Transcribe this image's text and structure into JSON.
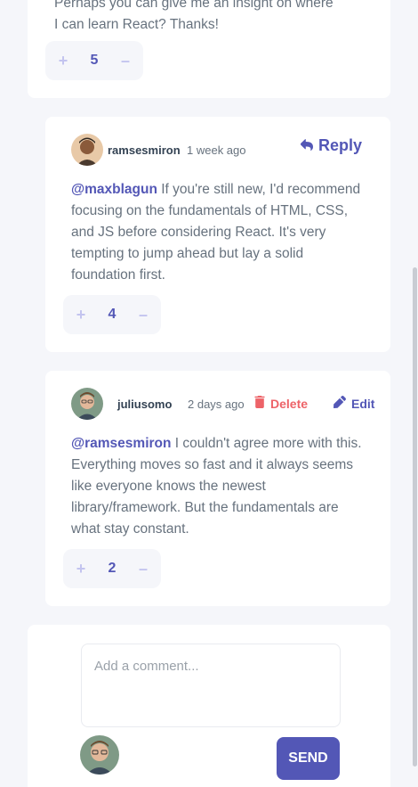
{
  "top_comment": {
    "text_line1": "Perhaps you can give me an insight on where",
    "text_line2": "I can learn React? Thanks!",
    "score": "5"
  },
  "reply_comment": {
    "username": "ramsesmiron",
    "time": "1 week ago",
    "reply_label": "Reply",
    "mention": "@maxblagun",
    "text": " If you're still new, I'd recommend focusing on the fundamentals of HTML, CSS, and JS before considering React. It's very tempting to jump ahead but lay a solid foundation first.",
    "score": "4"
  },
  "own_comment": {
    "username": "juliusomo",
    "time": "2 days ago",
    "delete_label": "Delete",
    "edit_label": "Edit",
    "mention": "@ramsesmiron",
    "text": " I couldn't agree more with this. Everything moves so fast and it always seems like everyone knows the newest library/framework. But the fundamentals are what stay constant.",
    "score": "2"
  },
  "vote": {
    "plus": "+",
    "minus": "–"
  },
  "compose": {
    "placeholder": "Add a comment...",
    "send_label": "SEND"
  },
  "colors": {
    "accent": "#5357b6",
    "danger": "#ed6368",
    "background": "#f5f6fa"
  },
  "icons": [
    "reply-icon",
    "trash-icon",
    "pencil-icon"
  ]
}
